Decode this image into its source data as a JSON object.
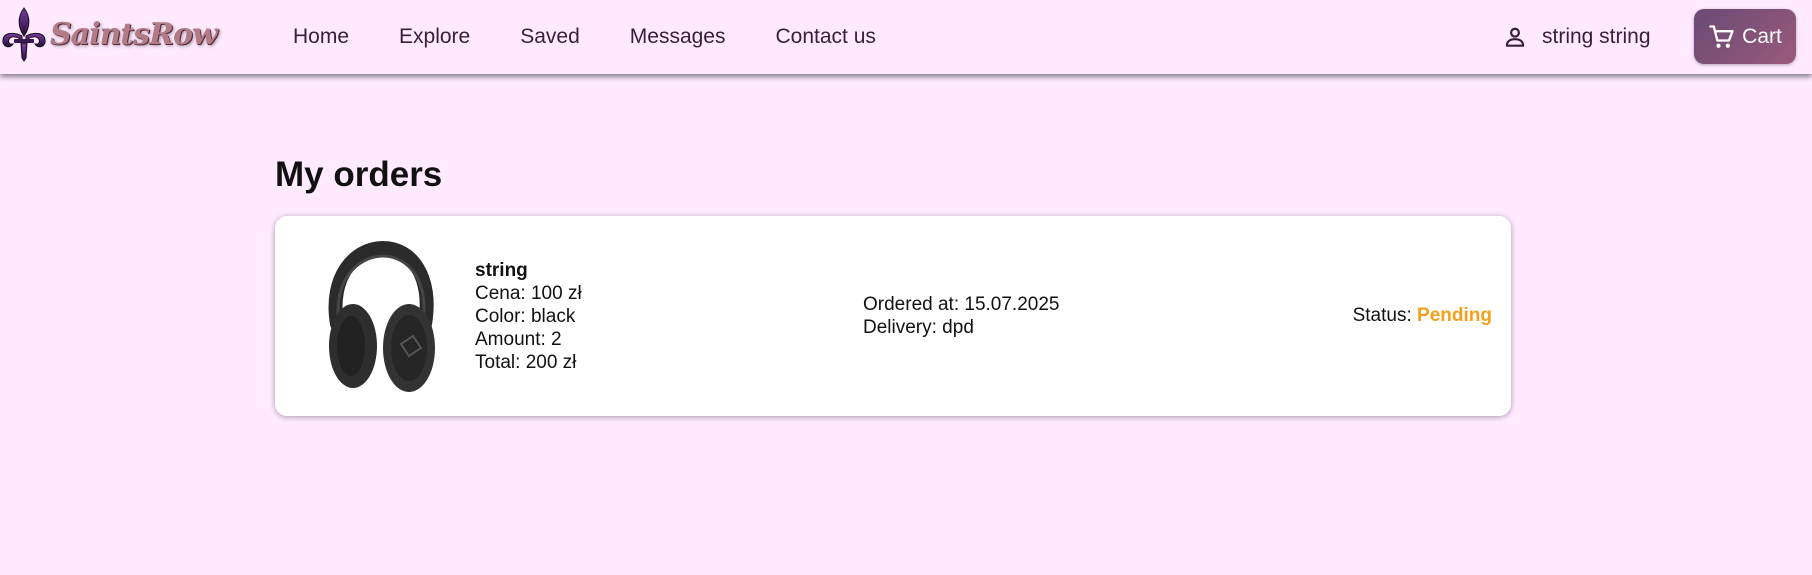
{
  "brand": {
    "logo_text": "SaintsRow",
    "icon": "fleur-de-lis-icon"
  },
  "nav": {
    "links": [
      {
        "label": "Home"
      },
      {
        "label": "Explore"
      },
      {
        "label": "Saved"
      },
      {
        "label": "Messages"
      },
      {
        "label": "Contact us"
      }
    ]
  },
  "user": {
    "name": "string string",
    "icon": "person-icon"
  },
  "cart": {
    "label": "Cart",
    "icon": "cart-icon"
  },
  "page": {
    "title": "My orders"
  },
  "orders": [
    {
      "image": "headphones-image",
      "name": "string",
      "price_line": "Cena: 100 zł",
      "color_line": "Color: black",
      "amount_line": "Amount: 2",
      "total_line": "Total: 200 zł",
      "ordered_line": "Ordered at: 15.07.2025",
      "delivery_line": "Delivery: dpd",
      "status_label": "Status:",
      "status_value": "Pending"
    }
  ],
  "colors": {
    "background": "#ffeaff",
    "nav_text": "#3a1d3a",
    "cart_gradient_start": "#6a4a74",
    "cart_gradient_end": "#9a5a7c",
    "status_pending": "#f5a01a"
  }
}
